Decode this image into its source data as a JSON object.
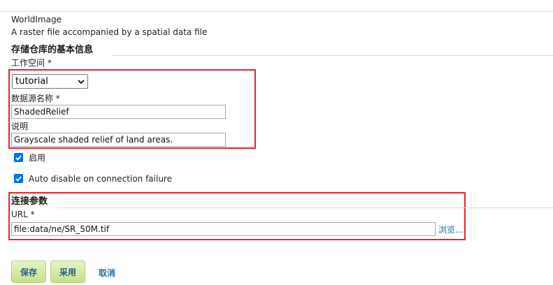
{
  "store": {
    "type_name": "WorldImage",
    "type_description": "A raster file accompanied by a spatial data file"
  },
  "basic_info": {
    "heading": "存储仓库的基本信息",
    "workspace_label": "工作空间 *",
    "workspace_value": "tutorial",
    "datasource_label": "数据源名称 *",
    "datasource_value": "ShadedRelief",
    "description_label": "说明",
    "description_value": "Grayscale shaded relief of land areas.",
    "enabled_label": "启用",
    "enabled_checked": true,
    "auto_disable_label": "Auto disable on connection failure",
    "auto_disable_checked": true
  },
  "connection": {
    "heading": "连接参数",
    "url_label": "URL *",
    "url_value": "file:data/ne/SR_50M.tif",
    "browse_label": "浏览..."
  },
  "actions": {
    "save_label": "保存",
    "apply_label": "采用",
    "cancel_label": "取消"
  },
  "colors": {
    "highlight_border": "#e4262b",
    "checkbox": "#0075ff",
    "button_bg": "#c6e08c",
    "link": "#1b6fa6"
  },
  "icons": {
    "dropdown": "chevron-down-icon",
    "check": "checkmark-icon"
  }
}
